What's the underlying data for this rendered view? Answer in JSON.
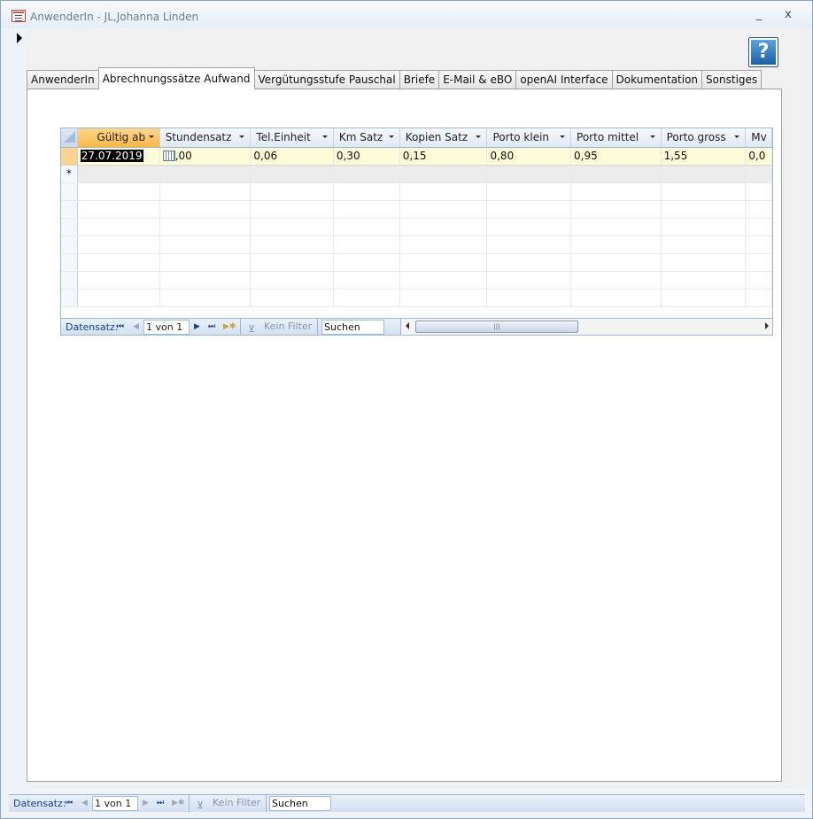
{
  "window": {
    "title": "AnwenderIn - JL,Johanna Linden",
    "minimize": "_",
    "close": "x"
  },
  "help": {
    "label": "?"
  },
  "tabs": [
    {
      "label": "AnwenderIn",
      "active": false
    },
    {
      "label": "Abrechnungssätze Aufwand",
      "active": true
    },
    {
      "label": "Vergütungsstufe Pauschal",
      "active": false
    },
    {
      "label": "Briefe",
      "active": false
    },
    {
      "label": "E-Mail & eBO",
      "active": false
    },
    {
      "label": "openAI Interface",
      "active": false
    },
    {
      "label": "Dokumentation",
      "active": false
    },
    {
      "label": "Sonstiges",
      "active": false
    }
  ],
  "sheet": {
    "columns": [
      "Gültig ab",
      "Stundensatz",
      "Tel.Einheit",
      "Km Satz",
      "Kopien Satz",
      "Porto klein",
      "Porto mittel",
      "Porto gross",
      "Mv"
    ],
    "row": [
      "27.07.2019",
      ",00",
      "0,06",
      "0,30",
      "0,15",
      "0,80",
      "0,95",
      "1,55",
      "0,0"
    ],
    "new_row_marker": "*",
    "nav": {
      "label": "Datensatz:",
      "position": "1 von 1",
      "filter": "Kein Filter",
      "search": "Suchen"
    }
  },
  "main_nav": {
    "label": "Datensatz:",
    "position": "1 von 1",
    "filter": "Kein Filter",
    "search": "Suchen"
  },
  "colors": {
    "selected_header": "#f7b84a",
    "current_row": "#fdfbd8",
    "nav_text": "#15428b"
  }
}
